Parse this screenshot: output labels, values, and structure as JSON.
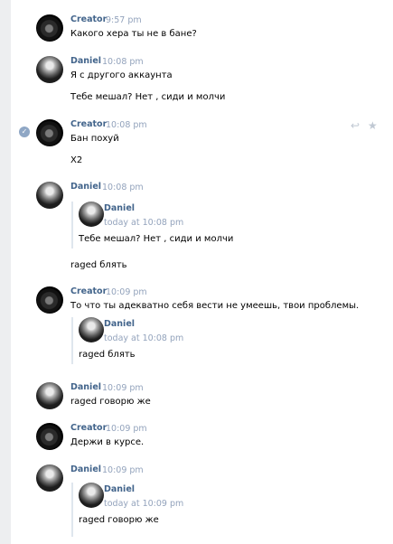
{
  "messages": [
    {
      "author": "Creator",
      "time": "9:57 pm",
      "lines": [
        "Какого хера ты не в бане?"
      ]
    },
    {
      "author": "Daniel",
      "time": "10:08 pm",
      "lines": [
        "Я с другого аккаунта",
        "Тебе мешал? Нет , сиди и молчи"
      ]
    },
    {
      "author": "Creator",
      "time": "10:08 pm",
      "lines": [
        "Бан похуй",
        "X2"
      ],
      "actions": {
        "reply_icon": "reply-icon",
        "star_icon": "star-icon"
      },
      "check_icon": "check-icon"
    },
    {
      "author": "Daniel",
      "time": "10:08 pm",
      "quote": {
        "author": "Daniel",
        "time": "today at 10:08 pm",
        "text": "Тебе мешал? Нет , сиди и молчи"
      },
      "lines": [
        "raged блять"
      ]
    },
    {
      "author": "Creator",
      "time": "10:09 pm",
      "lines": [
        "То что ты адекватно себя вести не умеешь, твои проблемы."
      ],
      "quote": {
        "author": "Daniel",
        "time": "today at 10:08 pm",
        "text": "raged блять"
      }
    },
    {
      "author": "Daniel",
      "time": "10:09 pm",
      "lines": [
        "raged говорю же"
      ]
    },
    {
      "author": "Creator",
      "time": "10:09 pm",
      "lines": [
        "Держи в курсе."
      ]
    },
    {
      "author": "Daniel",
      "time": "10:09 pm",
      "quote": {
        "author": "Daniel",
        "time": "today at 10:09 pm",
        "text": "raged говорю же"
      }
    }
  ]
}
